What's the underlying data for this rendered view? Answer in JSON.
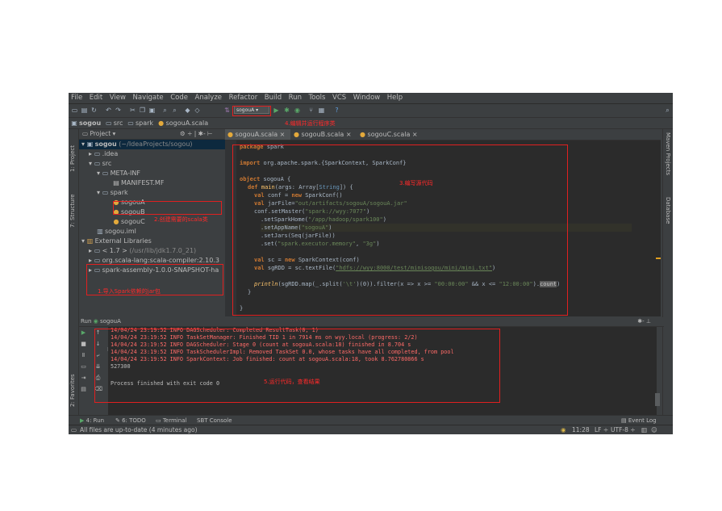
{
  "menu": [
    "File",
    "Edit",
    "View",
    "Navigate",
    "Code",
    "Analyze",
    "Refactor",
    "Build",
    "Run",
    "Tools",
    "VCS",
    "Window",
    "Help"
  ],
  "toolbar": {
    "run_config": "sogouA",
    "help": "?"
  },
  "annotations": {
    "a1": "4.编辑并运行程序类",
    "a2": "3.编写源代码",
    "a3": "2.创建需要的scala类",
    "a4": "1.导入Spark依赖的jar包",
    "a5": "5.运行代码，查看结果"
  },
  "breadcrumb": [
    "sogou",
    "src",
    "spark",
    "sogouA.scala"
  ],
  "project": {
    "header": "Project",
    "rows": [
      {
        "label": "sogou",
        "extra": "(~/IdeaProjects/sogou)"
      },
      {
        "label": ".idea"
      },
      {
        "label": "src"
      },
      {
        "label": "META-INF"
      },
      {
        "label": "MANIFEST.MF"
      },
      {
        "label": "spark"
      },
      {
        "label": "sogouA"
      },
      {
        "label": "sogouB"
      },
      {
        "label": "sogouC"
      },
      {
        "label": "sogou.iml"
      },
      {
        "label": "External Libraries"
      },
      {
        "label": "< 1.7 >",
        "extra": "(/usr/lib/jdk1.7.0_21)"
      },
      {
        "label": "org.scala-lang:scala-compiler:2.10.3"
      },
      {
        "label": "spark-assembly-1.0.0-SNAPSHOT-ha"
      }
    ]
  },
  "tabs": [
    "sogouA.scala",
    "sogouB.scala",
    "sogouC.scala"
  ],
  "code": {
    "l1_kw": "package",
    "l1": " spark",
    "l2_kw": "import",
    "l2": " org.apache.spark.{SparkContext, SparkConf}",
    "l3_kw": "object",
    "l3": " sogouA {",
    "l4_kw": "def",
    "l4_fn": " main",
    "l4a": "(args: Array[",
    "l4_type": "String",
    "l4b": "]) {",
    "l5_kw": "val",
    "l5a": " conf = ",
    "l5_kw2": "new",
    "l5b": " SparkConf()",
    "l6_kw": "val",
    "l6a": " jarFile=",
    "l6_str": "\"out/artifacts/sogouA/sogouA.jar\"",
    "l7a": "conf.setMaster(",
    "l7_str": "\"spark://wyy:7077\"",
    "l7b": ")",
    "l8a": ".setSparkHome(",
    "l8_str": "\"/app/hadoop/spark100\"",
    "l8b": ")",
    "l9a": ".setAppName(",
    "l9_str": "\"sogouA\"",
    "l9b": ")",
    "l10a": ".setJars(Seq(jarFile))",
    "l11a": ".set(",
    "l11_str": "\"spark.executor.memory\"",
    "l11b": ", ",
    "l11_str2": "\"3g\"",
    "l11c": ")",
    "l12_kw": "val",
    "l12a": " sc = ",
    "l12_kw2": "new",
    "l12b": " SparkContext(conf)",
    "l13_kw": "val",
    "l13a": " sgRDD = sc.textFile(",
    "l13_str": "\"hdfs://wyy:8000/test/minisogou/mini/mini.txt\"",
    "l13b": ")",
    "l14_fn": "println",
    "l14a": "(sgRDD.map(_.split(",
    "l14_str": "'\\t'",
    "l14b": ")(0)).filter(x => x >= ",
    "l14_str2": "\"00:00:00\"",
    "l14c": " && x <= ",
    "l14_str3": "\"12:00:00\"",
    "l14d": ").",
    "l14_sel": "count",
    "l14e": ")",
    "l15": "}",
    "l16": "}"
  },
  "run": {
    "header": "sogouA",
    "log": [
      "14/04/24 23:19:52 INFO DAGScheduler: Completed ResultTask(0, 1)",
      "14/04/24 23:19:52 INFO TaskSetManager: Finished TID 1 in 7914 ms on wyy.local (progress: 2/2)",
      "14/04/24 23:19:52 INFO DAGScheduler: Stage 0 (count at sogouA.scala:18) finished in 8.704 s",
      "14/04/24 23:19:52 INFO TaskSchedulerImpl: Removed TaskSet 0.0, whose tasks have all completed, from pool",
      "14/04/24 23:19:52 INFO SparkContext: Job finished: count at sogouA.scala:18, took 8.762780866 s"
    ],
    "result": "527300",
    "finished": "Process finished with exit code 0"
  },
  "side_tabs": {
    "project": "1: Project",
    "structure": "7: Structure",
    "favorites": "2: Favorites",
    "maven": "Maven Projects",
    "database": "Database"
  },
  "bottom_tabs": [
    "4: Run",
    "6: TODO",
    "Terminal",
    "SBT Console"
  ],
  "event_log": "Event Log",
  "status": {
    "message": "All files are up-to-date (4 minutes ago)",
    "position": "11:28",
    "line_sep": "LF ÷",
    "encoding": "UTF-8 ÷"
  },
  "colors": {
    "bg": "#3c3f41",
    "editor": "#2b2b2b",
    "annotation": "#e02020",
    "keyword": "#cc7832",
    "string": "#6a8759"
  }
}
